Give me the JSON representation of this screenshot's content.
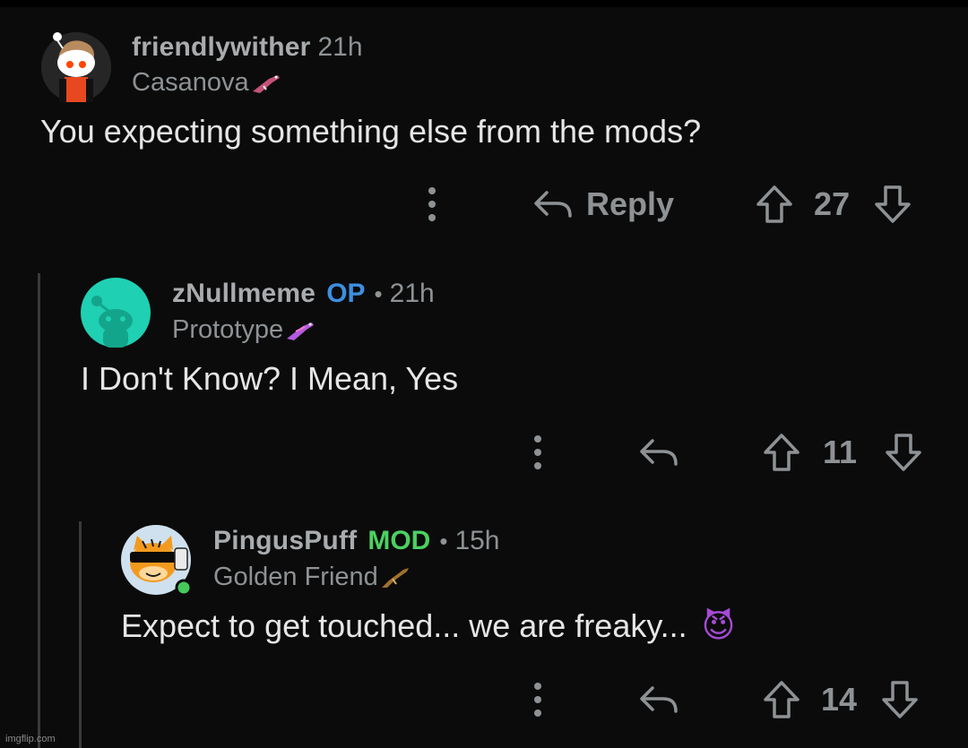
{
  "comments": [
    {
      "username": "friendlywither",
      "time": "21h",
      "flair": "Casanova",
      "text": "You expecting something else from the mods?",
      "reply_label": "Reply",
      "score": "27"
    },
    {
      "username": "zNullmeme",
      "badge": "OP",
      "separator": "•",
      "time": "21h",
      "flair": "Prototype",
      "text": "I Don't Know? I Mean, Yes",
      "score": "11"
    },
    {
      "username": "PingusPuff",
      "badge": "MOD",
      "separator": "•",
      "time": "15h",
      "flair": "Golden Friend",
      "text": "Expect to get touched... we are freaky...",
      "emoji": "😈",
      "score": "14"
    }
  ],
  "watermark": "imgflip.com",
  "colors": {
    "background": "#0b0b0b",
    "op_badge": "#3d8fe0",
    "mod_badge": "#4bd160",
    "muted": "#8e9295"
  }
}
